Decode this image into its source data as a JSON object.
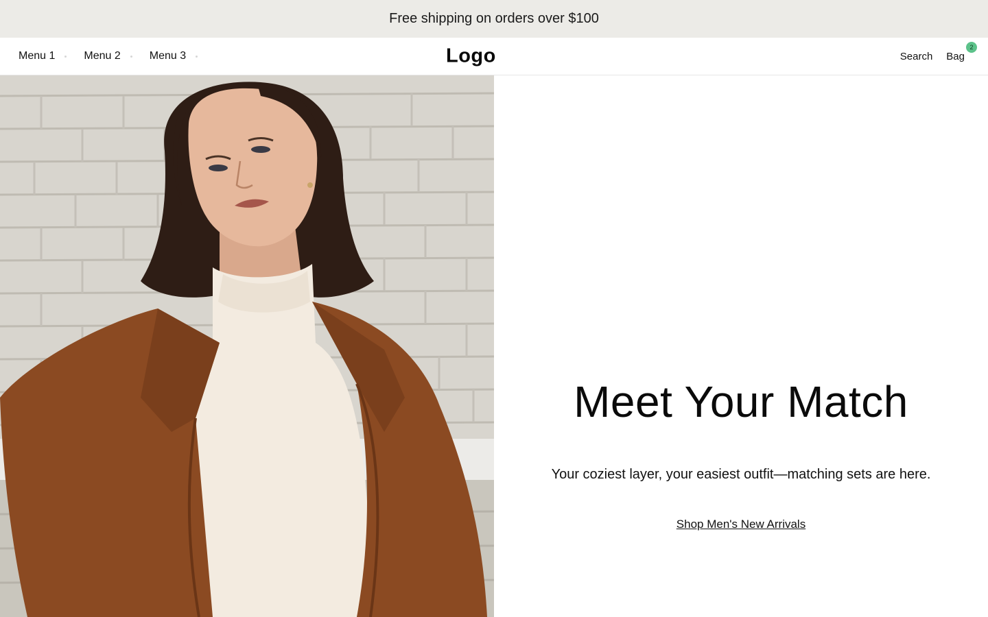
{
  "announcement": {
    "text": "Free shipping on orders over $100"
  },
  "header": {
    "nav": [
      {
        "label": "Menu 1"
      },
      {
        "label": "Menu 2"
      },
      {
        "label": "Menu 3"
      }
    ],
    "logo": "Logo",
    "search_label": "Search",
    "bag_label": "Bag",
    "bag_count": "2"
  },
  "hero": {
    "title": "Meet Your Match",
    "subtitle": "Your coziest layer, your easiest outfit—matching sets are here.",
    "cta_label": "Shop Men's New Arrivals"
  },
  "colors": {
    "announcement_bg": "#ecebe7",
    "badge": "#5cc28a",
    "coat": "#8b4a22",
    "sweater": "#f3ebe0",
    "wall": "#d9d6cf"
  }
}
